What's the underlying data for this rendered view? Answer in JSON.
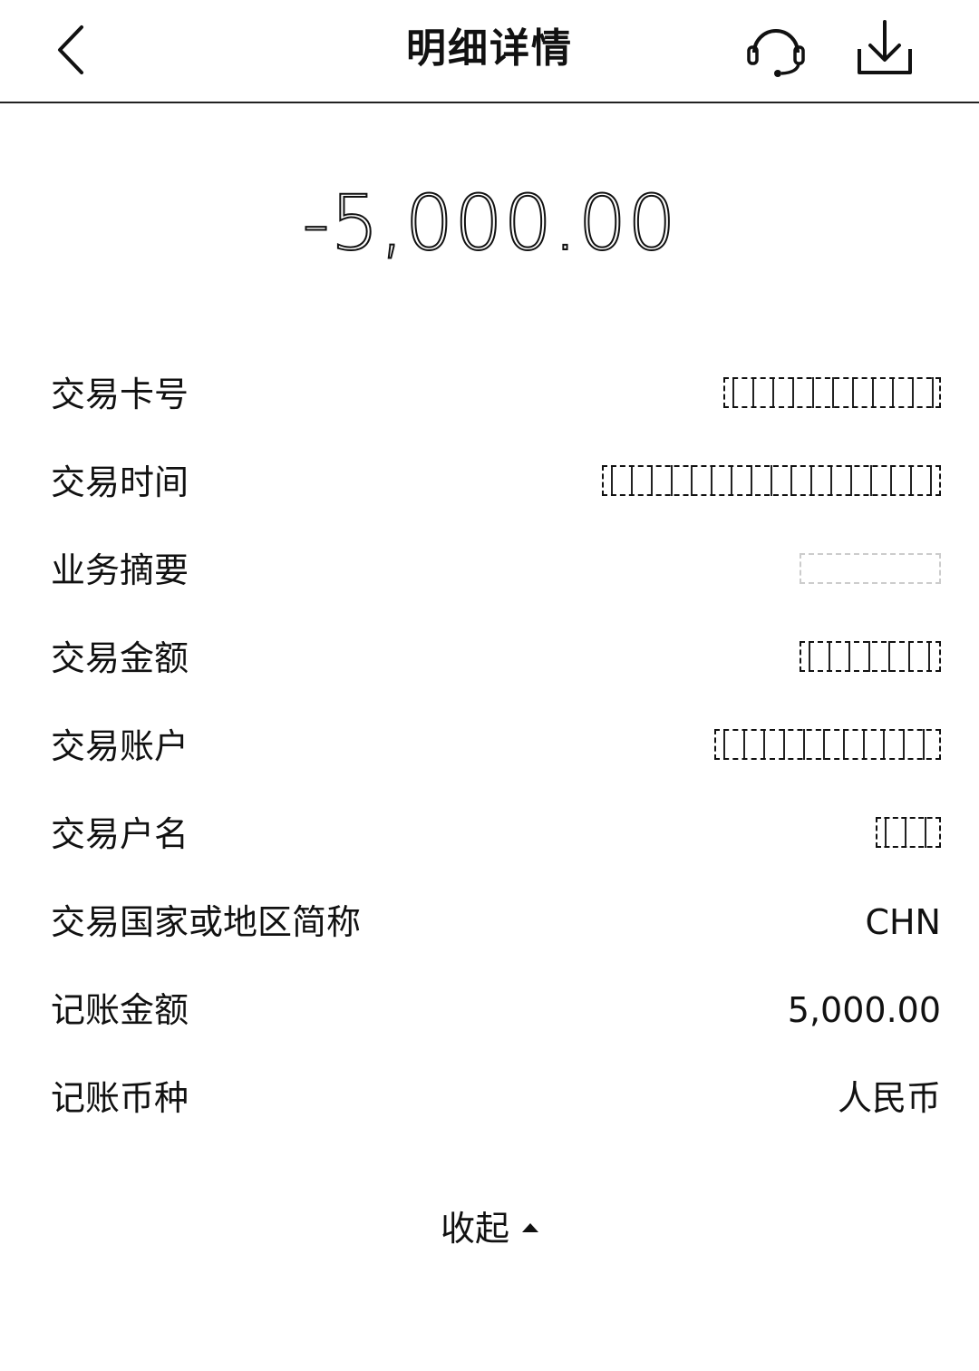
{
  "header": {
    "title": "明细详情",
    "back_icon": "chevron-left-icon",
    "service_icon": "headset-icon",
    "download_icon": "download-icon"
  },
  "amount": "-5,000.00",
  "details": [
    {
      "label": "交易卡号",
      "value": ""
    },
    {
      "label": "交易时间",
      "value": ""
    },
    {
      "label": "业务摘要",
      "value": ""
    },
    {
      "label": "交易金额",
      "value": ""
    },
    {
      "label": "交易账户",
      "value": ""
    },
    {
      "label": "交易户名",
      "value": ""
    },
    {
      "label": "交易国家或地区简称",
      "value": "CHN"
    },
    {
      "label": "记账金额",
      "value": "5,000.00"
    },
    {
      "label": "记账币种",
      "value": "人民币"
    }
  ],
  "collapse_label": "收起",
  "collapse_icon": "caret-up-icon"
}
